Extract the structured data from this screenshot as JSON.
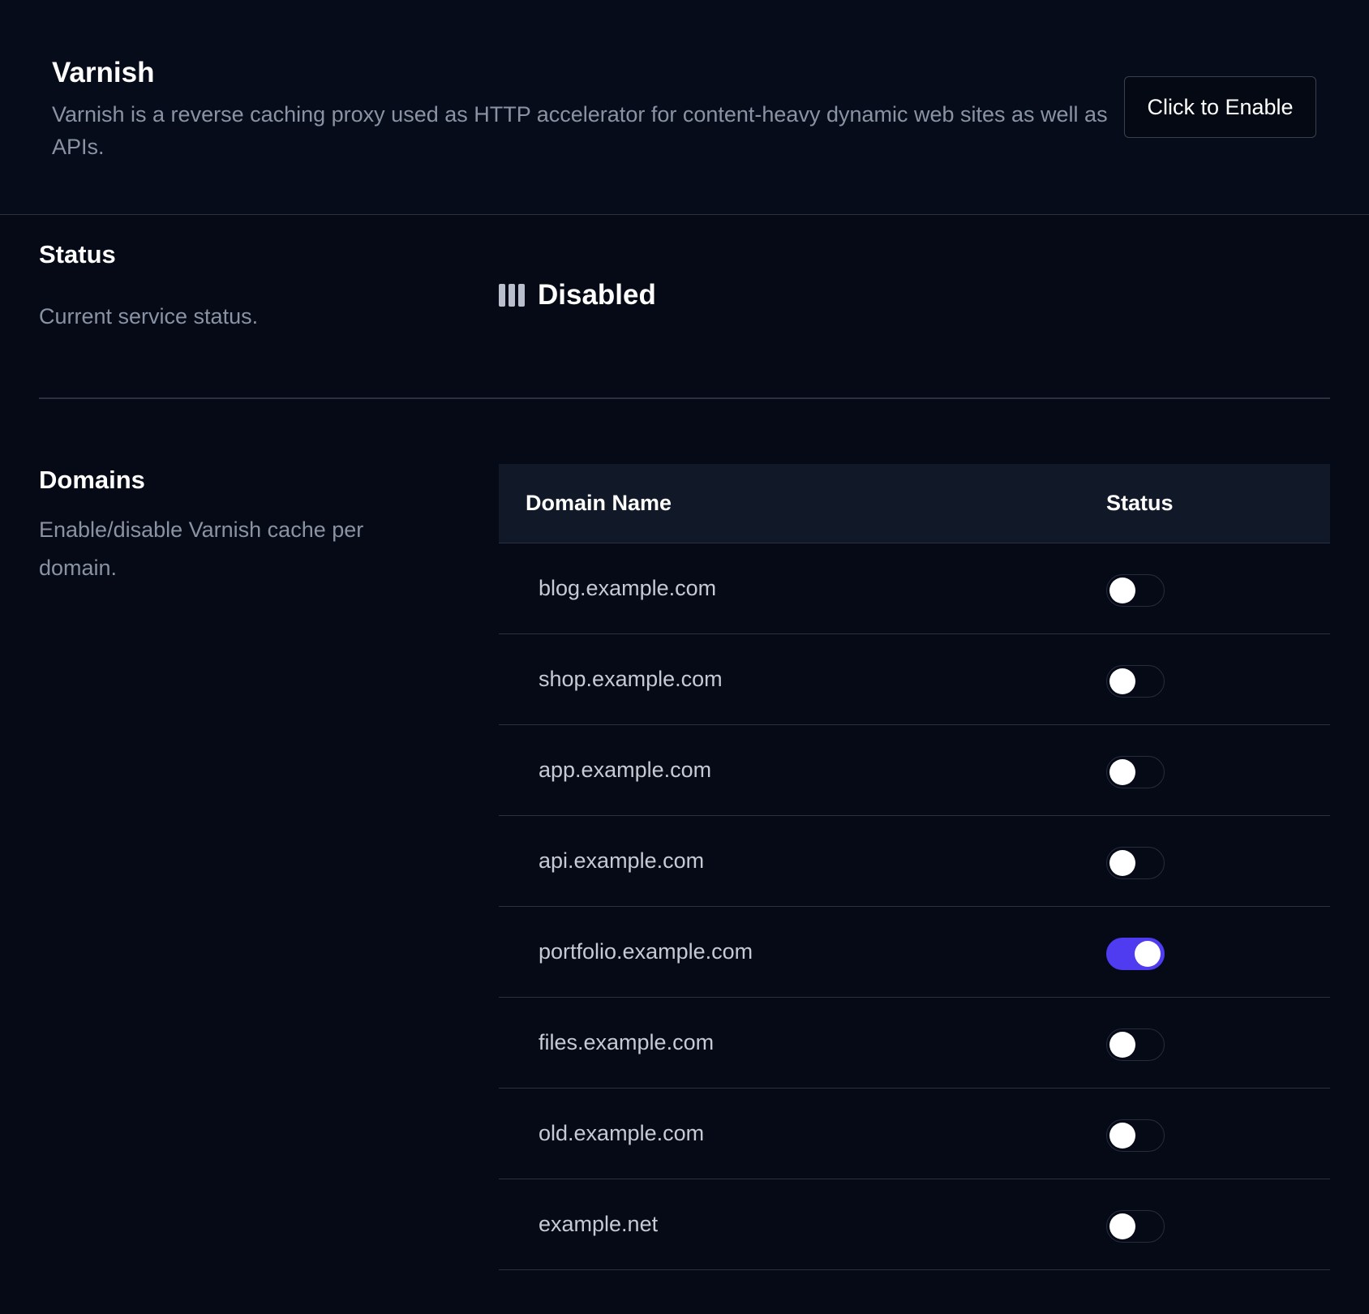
{
  "header": {
    "title": "Varnish",
    "description": "Varnish is a reverse caching proxy used as HTTP accelerator for content-heavy dynamic web sites as well as APIs.",
    "enable_button_label": "Click to Enable"
  },
  "status_section": {
    "title": "Status",
    "description": "Current service status.",
    "value": "Disabled",
    "icon": "bars-icon"
  },
  "domains_section": {
    "title": "Domains",
    "description": "Enable/disable Varnish cache per domain.",
    "columns": [
      "Domain Name",
      "Status"
    ],
    "rows": [
      {
        "domain": "blog.example.com",
        "enabled": false
      },
      {
        "domain": "shop.example.com",
        "enabled": false
      },
      {
        "domain": "app.example.com",
        "enabled": false
      },
      {
        "domain": "api.example.com",
        "enabled": false
      },
      {
        "domain": "portfolio.example.com",
        "enabled": true
      },
      {
        "domain": "files.example.com",
        "enabled": false
      },
      {
        "domain": "old.example.com",
        "enabled": false
      },
      {
        "domain": "example.net",
        "enabled": false
      }
    ]
  },
  "colors": {
    "background": "#050a16",
    "accent": "#4f3cf0",
    "muted_text": "#8a93a3",
    "border": "#2a3140"
  }
}
